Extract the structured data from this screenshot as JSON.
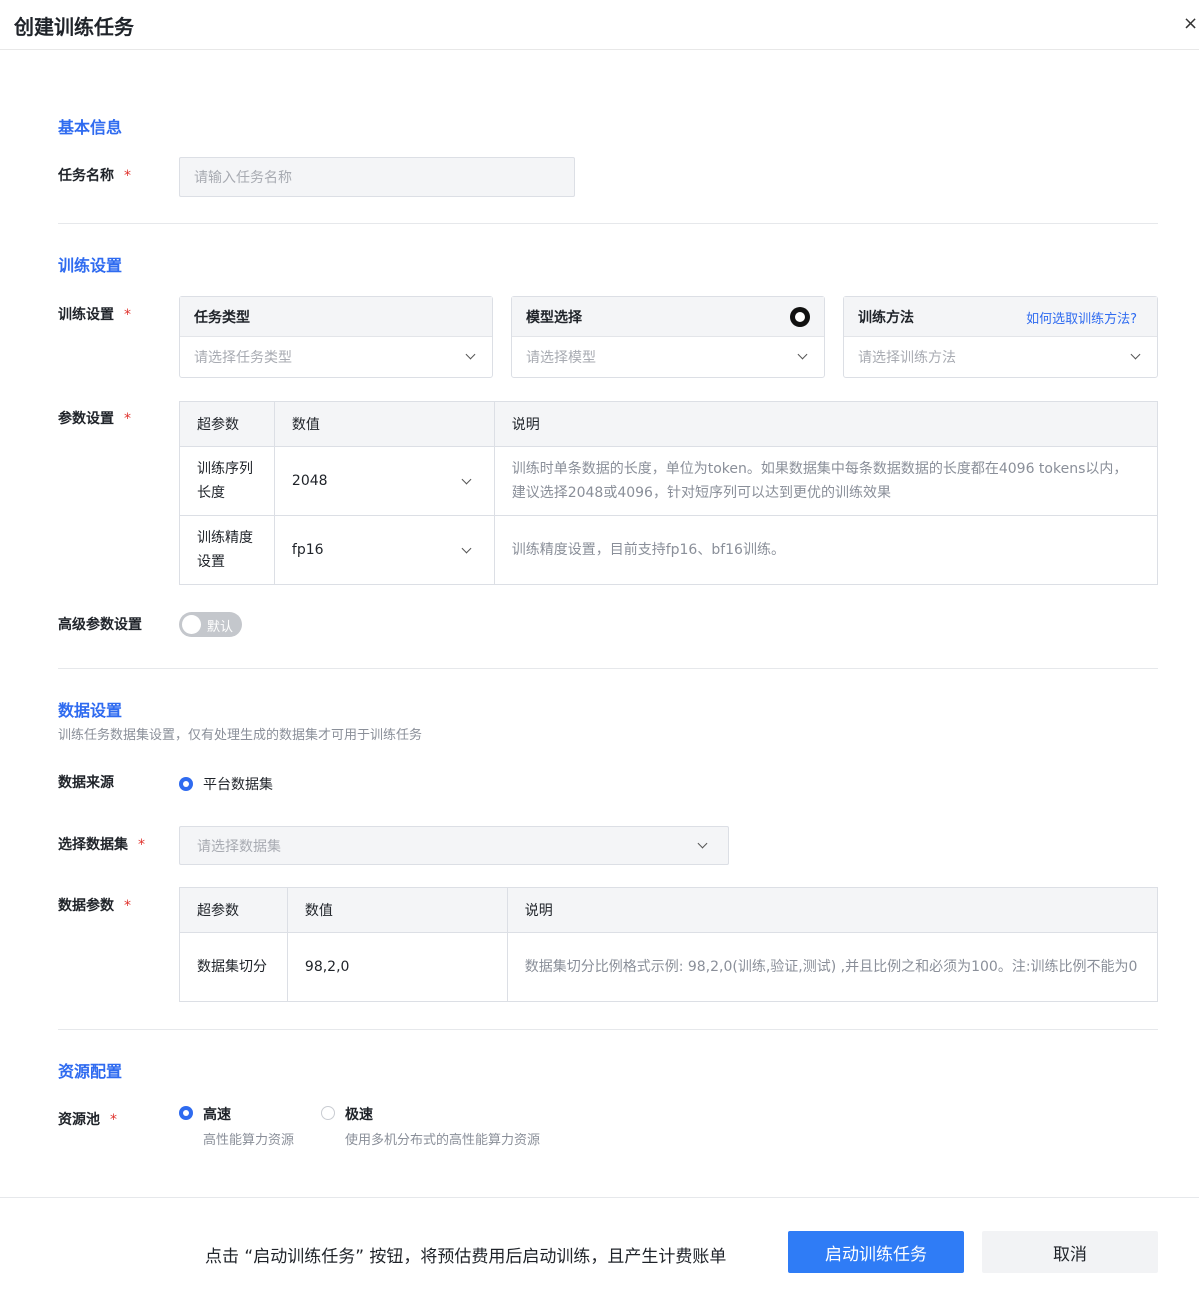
{
  "dialog": {
    "title": "创建训练任务",
    "close_icon": "×"
  },
  "basic": {
    "section_title": "基本信息",
    "task_name_label": "任务名称",
    "required_mark": "*",
    "task_name_placeholder": "请输入任务名称"
  },
  "training": {
    "section_title": "训练设置",
    "settings_label": "训练设置",
    "cards": [
      {
        "title": "任务类型",
        "placeholder": "请选择任务类型"
      },
      {
        "title": "模型选择",
        "placeholder": "请选择模型",
        "icon": "github-icon"
      },
      {
        "title": "训练方法",
        "placeholder": "请选择训练方法",
        "help_link": "如何选取训练方法?"
      }
    ],
    "params_label": "参数设置",
    "params_headers": [
      "超参数",
      "数值",
      "说明"
    ],
    "params_rows": [
      {
        "name": "训练序列长度",
        "value": "2048",
        "desc": "训练时单条数据的长度，单位为token。如果数据集中每条数据数据的长度都在4096 tokens以内，建议选择2048或4096，针对短序列可以达到更优的训练效果"
      },
      {
        "name": "训练精度设置",
        "value": "fp16",
        "desc": "训练精度设置，目前支持fp16、bf16训练。"
      }
    ],
    "advanced_label": "高级参数设置",
    "advanced_toggle_text": "默认",
    "advanced_enabled": false
  },
  "data": {
    "section_title": "数据设置",
    "section_subtitle": "训练任务数据集设置，仅有处理生成的数据集才可用于训练任务",
    "source_label": "数据来源",
    "source_option": "平台数据集",
    "dataset_label": "选择数据集",
    "dataset_placeholder": "请选择数据集",
    "params_label": "数据参数",
    "params_headers": [
      "超参数",
      "数值",
      "说明"
    ],
    "params_rows": [
      {
        "name": "数据集切分",
        "value": "98,2,0",
        "desc": "数据集切分比例格式示例: 98,2,0(训练,验证,测试) ,并且比例之和必须为100。注:训练比例不能为0"
      }
    ]
  },
  "resource": {
    "section_title": "资源配置",
    "pool_label": "资源池",
    "options": [
      {
        "title": "高速",
        "desc": "高性能算力资源",
        "selected": true
      },
      {
        "title": "极速",
        "desc": "使用多机分布式的高性能算力资源",
        "selected": false
      }
    ]
  },
  "footer": {
    "notice": "点击 “启动训练任务” 按钮，将预估费用后启动训练，且产生计费账单",
    "submit_label": "启动训练任务",
    "cancel_label": "取消"
  },
  "colors": {
    "accent": "#2f6bf0",
    "primary_button": "#2f7cf6",
    "required": "#e0322d"
  }
}
